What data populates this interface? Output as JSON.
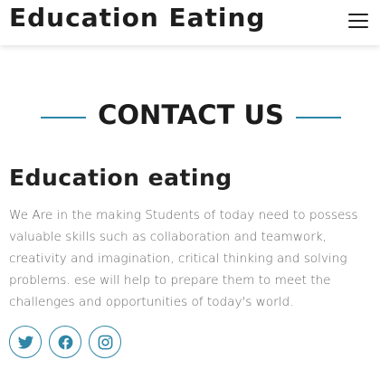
{
  "header": {
    "brand": "Education Eating",
    "menu_icon": "hamburger-menu-icon"
  },
  "contact": {
    "heading": "CONTACT US",
    "title": "Education eating",
    "body": "We Are in the making Students of today need to possess valuable skills such as collaboration and teamwork, creativity and imagination, critical thinking and solving problems. ese will help to prepare them to meet the challenges and opportunities of today's world.",
    "accent_color": "#2f86a6"
  },
  "social": [
    {
      "icon": "twitter-icon"
    },
    {
      "icon": "facebook-icon"
    },
    {
      "icon": "instagram-icon"
    }
  ]
}
